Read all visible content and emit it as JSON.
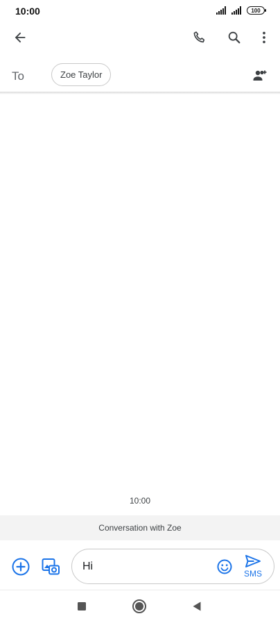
{
  "status_bar": {
    "time": "10:00",
    "battery": "100"
  },
  "header": {
    "back_icon": "arrow-back-icon",
    "call_icon": "phone-icon",
    "search_icon": "search-icon",
    "more_icon": "more-vert-icon"
  },
  "recipients": {
    "to_label": "To",
    "chip_label": "Zoe Taylor",
    "add_icon": "add-person-icon"
  },
  "conversation": {
    "time": "10:00",
    "banner": "Conversation with Zoe"
  },
  "compose": {
    "text": "Hi",
    "send_label": "SMS"
  },
  "colors": {
    "accent": "#1a73e8",
    "icon_dark": "#3c4043",
    "banner_bg": "#f3f3f3"
  }
}
